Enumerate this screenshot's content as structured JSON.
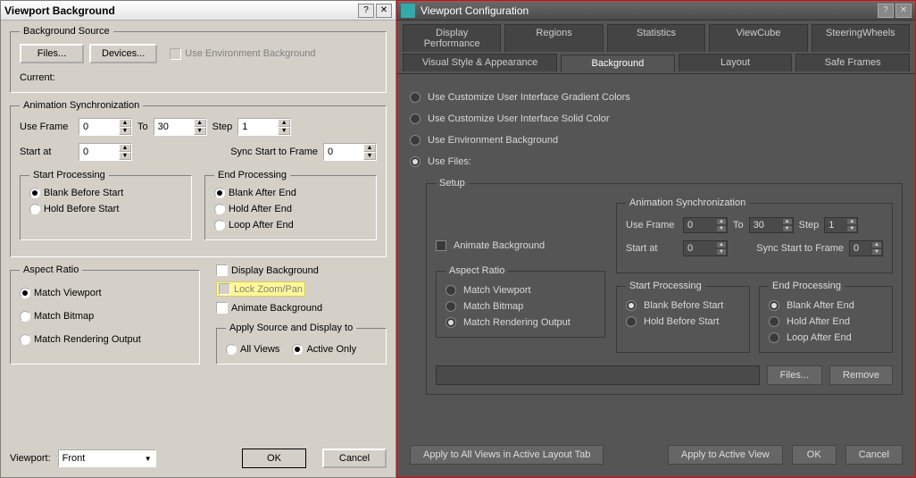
{
  "left": {
    "title": "Viewport Background",
    "bg_source": {
      "legend": "Background Source",
      "files_btn": "Files...",
      "devices_btn": "Devices...",
      "use_env_chk": "Use Environment Background",
      "current_label": "Current:"
    },
    "anim_sync": {
      "legend": "Animation Synchronization",
      "use_frame": "Use Frame",
      "use_frame_val": "0",
      "to": "To",
      "to_val": "30",
      "step": "Step",
      "step_val": "1",
      "start_at": "Start at",
      "start_at_val": "0",
      "sync_start": "Sync Start to Frame",
      "sync_start_val": "0",
      "start_proc": {
        "legend": "Start Processing",
        "blank": "Blank Before Start",
        "hold": "Hold Before Start"
      },
      "end_proc": {
        "legend": "End Processing",
        "blank": "Blank After End",
        "hold": "Hold After End",
        "loop": "Loop After End"
      }
    },
    "aspect": {
      "legend": "Aspect Ratio",
      "match_viewport": "Match Viewport",
      "match_bitmap": "Match Bitmap",
      "match_render": "Match Rendering Output",
      "display_bg": "Display Background",
      "lock_zoom": "Lock Zoom/Pan",
      "animate_bg": "Animate Background",
      "apply_legend": "Apply Source and Display to",
      "all_views": "All Views",
      "active_only": "Active Only"
    },
    "footer": {
      "viewport_label": "Viewport:",
      "viewport_val": "Front",
      "ok": "OK",
      "cancel": "Cancel"
    }
  },
  "right": {
    "title": "Viewport Configuration",
    "tabs_top": [
      "Display Performance",
      "Regions",
      "Statistics",
      "ViewCube",
      "SteeringWheels"
    ],
    "tabs_bottom": [
      "Visual Style & Appearance",
      "Background",
      "Layout",
      "Safe Frames"
    ],
    "radios": {
      "gradient": "Use Customize User Interface Gradient Colors",
      "solid": "Use Customize User Interface Solid Color",
      "env": "Use Environment Background",
      "files": "Use Files:"
    },
    "setup": {
      "legend": "Setup",
      "animate_bg": "Animate Background",
      "aspect": {
        "legend": "Aspect Ratio",
        "match_viewport": "Match Viewport",
        "match_bitmap": "Match Bitmap",
        "match_render": "Match Rendering Output"
      },
      "anim_sync": {
        "legend": "Animation Synchronization",
        "use_frame": "Use Frame",
        "use_frame_val": "0",
        "to": "To",
        "to_val": "30",
        "step": "Step",
        "step_val": "1",
        "start_at": "Start at",
        "start_at_val": "0",
        "sync_start": "Sync Start to Frame",
        "sync_start_val": "0"
      },
      "start_proc": {
        "legend": "Start Processing",
        "blank": "Blank Before Start",
        "hold": "Hold Before Start"
      },
      "end_proc": {
        "legend": "End Processing",
        "blank": "Blank After End",
        "hold": "Hold After End",
        "loop": "Loop After End"
      },
      "files_btn": "Files...",
      "remove_btn": "Remove"
    },
    "footer": {
      "apply_all": "Apply to All Views in Active Layout Tab",
      "apply_active": "Apply to Active View",
      "ok": "OK",
      "cancel": "Cancel"
    }
  }
}
